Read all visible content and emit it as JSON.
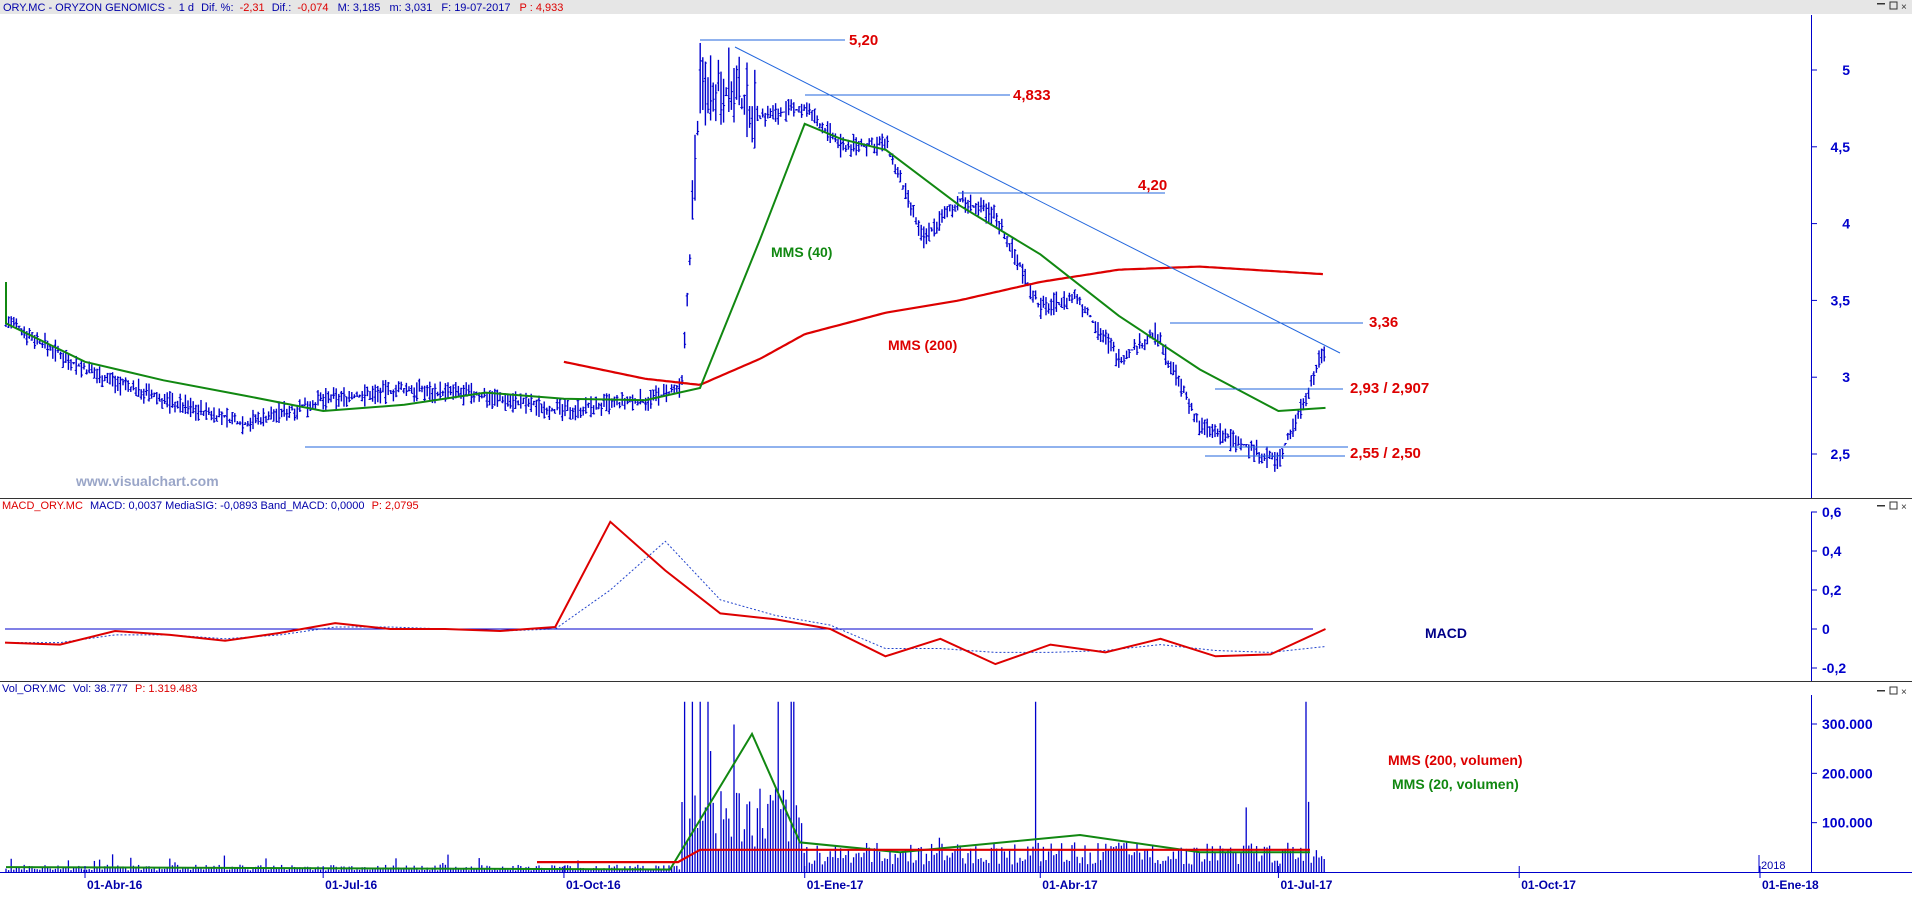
{
  "header": {
    "symbol": "ORY.MC - ORYZON GENOMICS -",
    "period": "1 d",
    "dif_pct_label": "Dif. %:",
    "dif_pct": "-2,31",
    "dif_label": "Dif.:",
    "dif": "-0,074",
    "max_label": "M: 3,185",
    "min_label": "m: 3,031",
    "date_label": "F: 19-07-2017",
    "price_label": "P : 4,933"
  },
  "macd_header": {
    "name": "MACD_ORY.MC",
    "text": "MACD: 0,0037  MediaSIG: -0,0893  Band_MACD: 0,0000",
    "p": "P: 2,0795"
  },
  "vol_header": {
    "name": "Vol_ORY.MC",
    "text": "Vol: 38.777",
    "p": "P: 1.319.483"
  },
  "watermark": "www.visualchart.com",
  "colors": {
    "price": "#0000cc",
    "mms40": "#008800",
    "mms200": "#dd0000",
    "annot": "#dd0000",
    "hline": "#2266dd",
    "axis": "#0000cc"
  },
  "chart_data": [
    {
      "type": "line",
      "panel": "price",
      "y_ticks": [
        "2,5",
        "3",
        "3,5",
        "4",
        "4,5",
        "5"
      ],
      "ylim": [
        2.3,
        5.3
      ],
      "x_ticks": [
        "01-Abr-16",
        "01-Jul-16",
        "01-Oct-16",
        "01-Ene-17",
        "01-Abr-17",
        "01-Jul-17",
        "01-Oct-17",
        "01-Ene-18"
      ],
      "year_marker": "2018",
      "series": [
        {
          "name": "ORY.MC",
          "x": [
            "01-Mar-16",
            "01-Abr-16",
            "01-May-16",
            "01-Jun-16",
            "01-Jul-16",
            "01-Ago-16",
            "01-Sep-16",
            "01-Oct-16",
            "01-Nov-16",
            "15-Nov-16",
            "22-Nov-16",
            "01-Dic-16",
            "15-Dic-16",
            "01-Ene-17",
            "15-Ene-17",
            "01-Feb-17",
            "15-Feb-17",
            "01-Mar-17",
            "15-Mar-17",
            "01-Abr-17",
            "15-Abr-17",
            "01-May-17",
            "15-May-17",
            "01-Jun-17",
            "15-Jun-17",
            "01-Jul-17",
            "19-Jul-17"
          ],
          "values": [
            3.38,
            3.05,
            2.85,
            2.7,
            2.85,
            2.92,
            2.88,
            2.78,
            2.85,
            2.92,
            4.9,
            4.9,
            4.7,
            4.75,
            4.5,
            4.52,
            3.9,
            4.15,
            4.05,
            3.45,
            3.52,
            3.12,
            3.28,
            2.68,
            2.58,
            2.45,
            3.2
          ]
        },
        {
          "name": "MMS (40)",
          "x": [
            "01-Feb-16",
            "01-Mar-16",
            "01-Abr-16",
            "01-May-16",
            "01-Jun-16",
            "01-Jul-16",
            "01-Ago-16",
            "01-Sep-16",
            "01-Oct-16",
            "01-Nov-16",
            "22-Nov-16",
            "15-Dic-16",
            "01-Ene-17",
            "15-Ene-17",
            "01-Feb-17",
            "01-Mar-17",
            "01-Abr-17",
            "01-May-17",
            "01-Jun-17",
            "01-Jul-17",
            "19-Jul-17"
          ],
          "values": [
            3.62,
            3.35,
            3.1,
            2.98,
            2.88,
            2.78,
            2.82,
            2.9,
            2.86,
            2.85,
            2.93,
            3.9,
            4.65,
            4.55,
            4.48,
            4.12,
            3.8,
            3.4,
            3.05,
            2.78,
            2.8
          ]
        },
        {
          "name": "MMS (200)",
          "x": [
            "01-Oct-16",
            "01-Nov-16",
            "22-Nov-16",
            "15-Dic-16",
            "01-Ene-17",
            "01-Feb-17",
            "01-Mar-17",
            "01-Abr-17",
            "01-May-17",
            "01-Jun-17",
            "19-Jul-17"
          ],
          "values": [
            3.1,
            2.99,
            2.95,
            3.12,
            3.28,
            3.42,
            3.5,
            3.62,
            3.7,
            3.72,
            3.67
          ]
        }
      ],
      "annotations": [
        "5,20",
        "4,833",
        "4,20",
        "3,36",
        "2,93 / 2,907",
        "2,55 / 2,50",
        "MMS (40)",
        "MMS (200)"
      ]
    },
    {
      "type": "line",
      "panel": "macd",
      "y_ticks": [
        "0,6",
        "0,4",
        "0,2",
        "0",
        "-0,2"
      ],
      "ylim": [
        -0.25,
        0.65
      ],
      "series": [
        {
          "name": "MACD",
          "values": [
            -0.07,
            -0.08,
            -0.01,
            -0.03,
            -0.06,
            -0.02,
            0.03,
            0.0,
            0.0,
            -0.01,
            0.01,
            0.55,
            0.3,
            0.08,
            0.05,
            0.0,
            -0.14,
            -0.05,
            -0.18,
            -0.08,
            -0.12,
            -0.05,
            -0.14,
            -0.13,
            0.0
          ]
        },
        {
          "name": "MediaSIG",
          "values": [
            -0.07,
            -0.07,
            -0.03,
            -0.03,
            -0.05,
            -0.03,
            0.01,
            0.01,
            0.0,
            -0.01,
            0.0,
            0.2,
            0.45,
            0.15,
            0.07,
            0.02,
            -0.1,
            -0.1,
            -0.12,
            -0.12,
            -0.11,
            -0.08,
            -0.11,
            -0.12,
            -0.09
          ]
        }
      ],
      "label": "MACD"
    },
    {
      "type": "bar",
      "panel": "volume",
      "y_ticks": [
        "100.000",
        "200.000",
        "300.000"
      ],
      "ylim": [
        0,
        370000
      ],
      "series": [
        {
          "name": "MMS (200, volumen)",
          "values": [
            20000,
            20000,
            45000,
            45000,
            45000,
            45000
          ]
        },
        {
          "name": "MMS (20, volumen)",
          "values": [
            10000,
            5000,
            280000,
            60000,
            40000,
            75000,
            40000,
            40000
          ]
        }
      ],
      "labels": [
        "MMS (200, volumen)",
        "MMS (20, volumen)"
      ]
    }
  ]
}
